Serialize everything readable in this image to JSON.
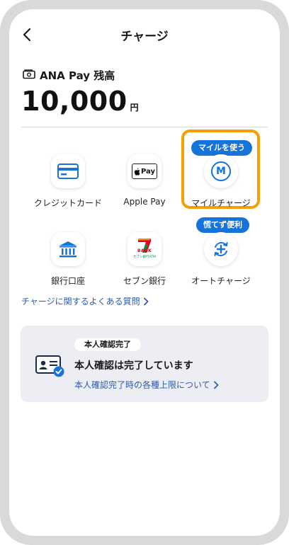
{
  "header": {
    "title": "チャージ"
  },
  "balance": {
    "label": "ANA Pay 残高",
    "amount": "10,000",
    "unit": "円"
  },
  "options": {
    "credit_card": {
      "label": "クレジットカード"
    },
    "apple_pay": {
      "label": "Apple Pay",
      "icon_text": "Pay"
    },
    "mile_charge": {
      "label": "マイルチャージ",
      "badge": "マイルを使う",
      "icon_letter": "M"
    },
    "bank": {
      "label": "銀行口座"
    },
    "seven_bank": {
      "label": "セブン銀行",
      "logo_text": "BANK",
      "logo_sub": "セブン銀行ATM"
    },
    "auto_charge": {
      "label": "オートチャージ",
      "badge": "慌てず便利"
    }
  },
  "faq": {
    "label": "チャージに関するよくある質問"
  },
  "verification": {
    "badge": "本人確認完了",
    "title": "本人確認は完了しています",
    "link": "本人確認完了時の各種上限について"
  },
  "colors": {
    "accent": "#1573d9",
    "highlight": "#f5a000",
    "link": "#2d5aa8",
    "card_bg": "#eceef3"
  }
}
